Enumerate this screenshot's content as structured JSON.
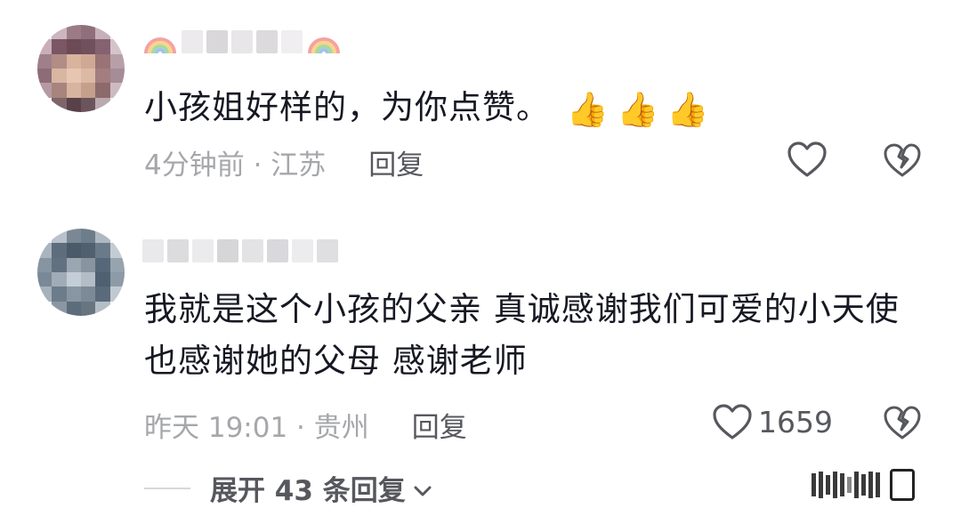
{
  "comments": [
    {
      "text": "小孩姐好样的，为你点赞。",
      "reactions": [
        "👍",
        "👍",
        "👍"
      ],
      "time_location": "4分钟前 · 江苏",
      "reply_label": "回复",
      "like_count": ""
    },
    {
      "text": "我就是这个小孩的父亲 真诚感谢我们可爱的小天使 也感谢她的父母 感谢老师",
      "time_location": "昨天 19:01 · 贵州",
      "reply_label": "回复",
      "like_count": "1659"
    }
  ],
  "expand_replies": "展开 43 条回复",
  "icons": {
    "like": "heart-outline-icon",
    "dislike": "broken-heart-icon",
    "expand": "chevron-down-icon",
    "reaction": "thumbs-up-emoji"
  },
  "colors": {
    "text_primary": "#161823",
    "text_secondary": "#a6a7ab",
    "action": "#57585e"
  }
}
